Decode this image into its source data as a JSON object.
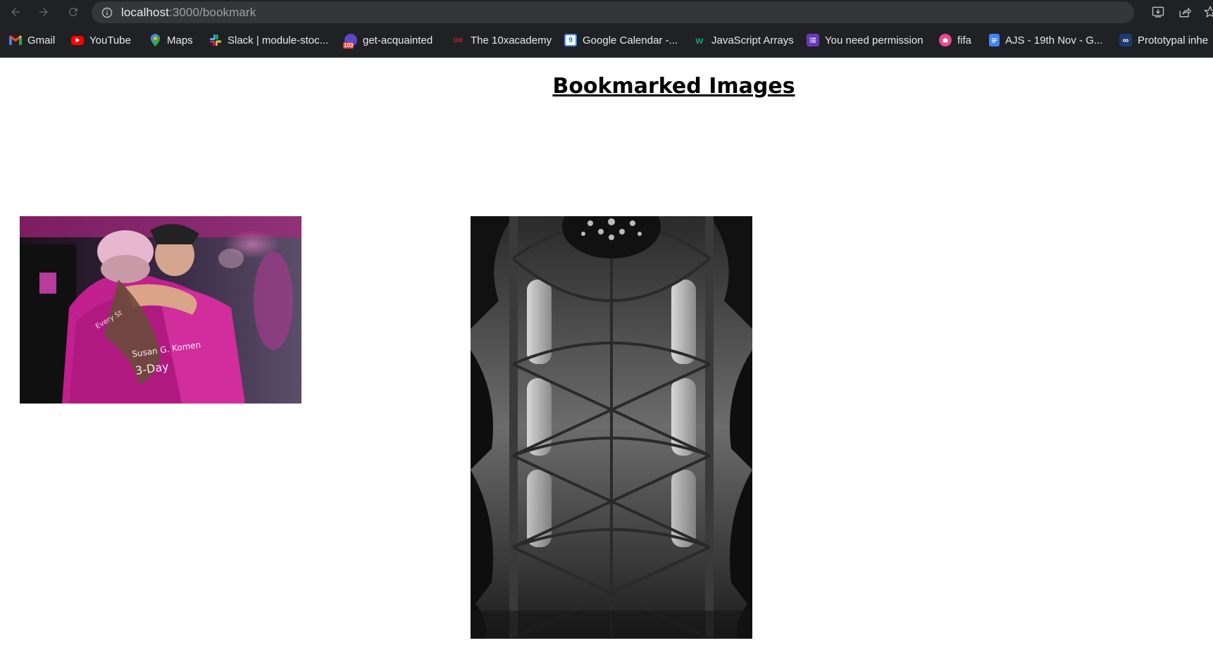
{
  "browser": {
    "url_host": "localhost",
    "url_rest": ":3000/bookmark"
  },
  "bookmarks": [
    {
      "label": "Gmail",
      "icon": "gmail-icon"
    },
    {
      "label": "YouTube",
      "icon": "youtube-icon"
    },
    {
      "label": "Maps",
      "icon": "maps-icon"
    },
    {
      "label": "Slack | module-stoc...",
      "icon": "slack-icon"
    },
    {
      "label": "get-acquainted",
      "icon": "badge-icon",
      "badge": "103"
    },
    {
      "label": "The 10xacademy",
      "icon": "10x-icon"
    },
    {
      "label": "Google Calendar -...",
      "icon": "calendar-icon",
      "badge": "9"
    },
    {
      "label": "JavaScript Arrays",
      "icon": "w3-icon"
    },
    {
      "label": "You need permission",
      "icon": "forms-icon"
    },
    {
      "label": "fifa",
      "icon": "fifa-icon"
    },
    {
      "label": "AJS - 19th Nov - G...",
      "icon": "docs-icon"
    },
    {
      "label": "Prototypal inhe",
      "icon": "codeinfinity-icon"
    }
  ],
  "page": {
    "title": "Bookmarked Images"
  },
  "images": [
    {
      "name": "hug-photo",
      "description_icon": "photo-icon"
    },
    {
      "name": "cathedral-ceiling-photo",
      "description_icon": "photo-icon"
    }
  ],
  "colors": {
    "chrome_bg": "#202124",
    "omnibox_bg": "#35363a",
    "text_light": "#e8eaed"
  }
}
